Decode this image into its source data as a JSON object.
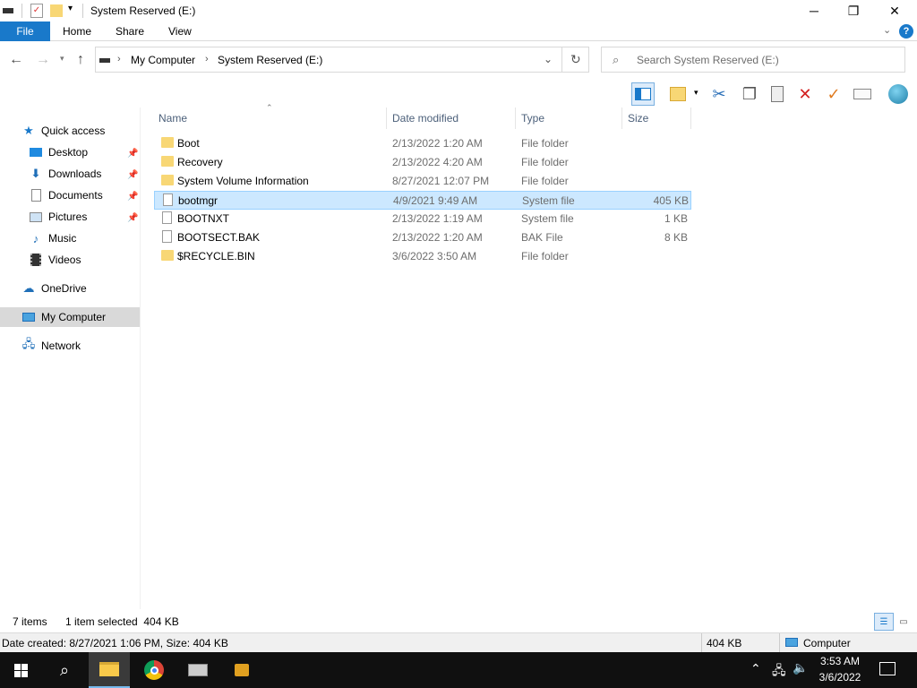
{
  "window": {
    "title": "System Reserved (E:)"
  },
  "ribbon": {
    "tabs": [
      "File",
      "Home",
      "Share",
      "View"
    ]
  },
  "address": {
    "crumbs": [
      "My Computer",
      "System Reserved (E:)"
    ],
    "search_placeholder": "Search System Reserved (E:)"
  },
  "nav": {
    "quick_access": "Quick access",
    "quick_items": [
      "Desktop",
      "Downloads",
      "Documents",
      "Pictures",
      "Music",
      "Videos"
    ],
    "onedrive": "OneDrive",
    "my_computer": "My Computer",
    "network": "Network"
  },
  "columns": {
    "name": "Name",
    "date": "Date modified",
    "type": "Type",
    "size": "Size"
  },
  "files": [
    {
      "name": "Boot",
      "date": "2/13/2022 1:20 AM",
      "type": "File folder",
      "size": "",
      "kind": "folder"
    },
    {
      "name": "Recovery",
      "date": "2/13/2022 4:20 AM",
      "type": "File folder",
      "size": "",
      "kind": "folder"
    },
    {
      "name": "System Volume Information",
      "date": "8/27/2021 12:07 PM",
      "type": "File folder",
      "size": "",
      "kind": "folder"
    },
    {
      "name": "bootmgr",
      "date": "4/9/2021 9:49 AM",
      "type": "System file",
      "size": "405 KB",
      "kind": "file",
      "selected": true
    },
    {
      "name": "BOOTNXT",
      "date": "2/13/2022 1:19 AM",
      "type": "System file",
      "size": "1 KB",
      "kind": "file"
    },
    {
      "name": "BOOTSECT.BAK",
      "date": "2/13/2022 1:20 AM",
      "type": "BAK File",
      "size": "8 KB",
      "kind": "file"
    },
    {
      "name": "$RECYCLE.BIN",
      "date": "3/6/2022 3:50 AM",
      "type": "File folder",
      "size": "",
      "kind": "folder"
    }
  ],
  "status": {
    "count": "7 items",
    "selected": "1 item selected  404 KB"
  },
  "details": {
    "text": "Date created: 8/27/2021 1:06 PM, Size: 404 KB",
    "size": "404 KB",
    "location": "Computer"
  },
  "taskbar": {
    "time": "3:53 AM",
    "date": "3/6/2022"
  },
  "colors": {
    "accent": "#1979ca",
    "selection": "#cce8ff",
    "taskbar": "#101010"
  }
}
